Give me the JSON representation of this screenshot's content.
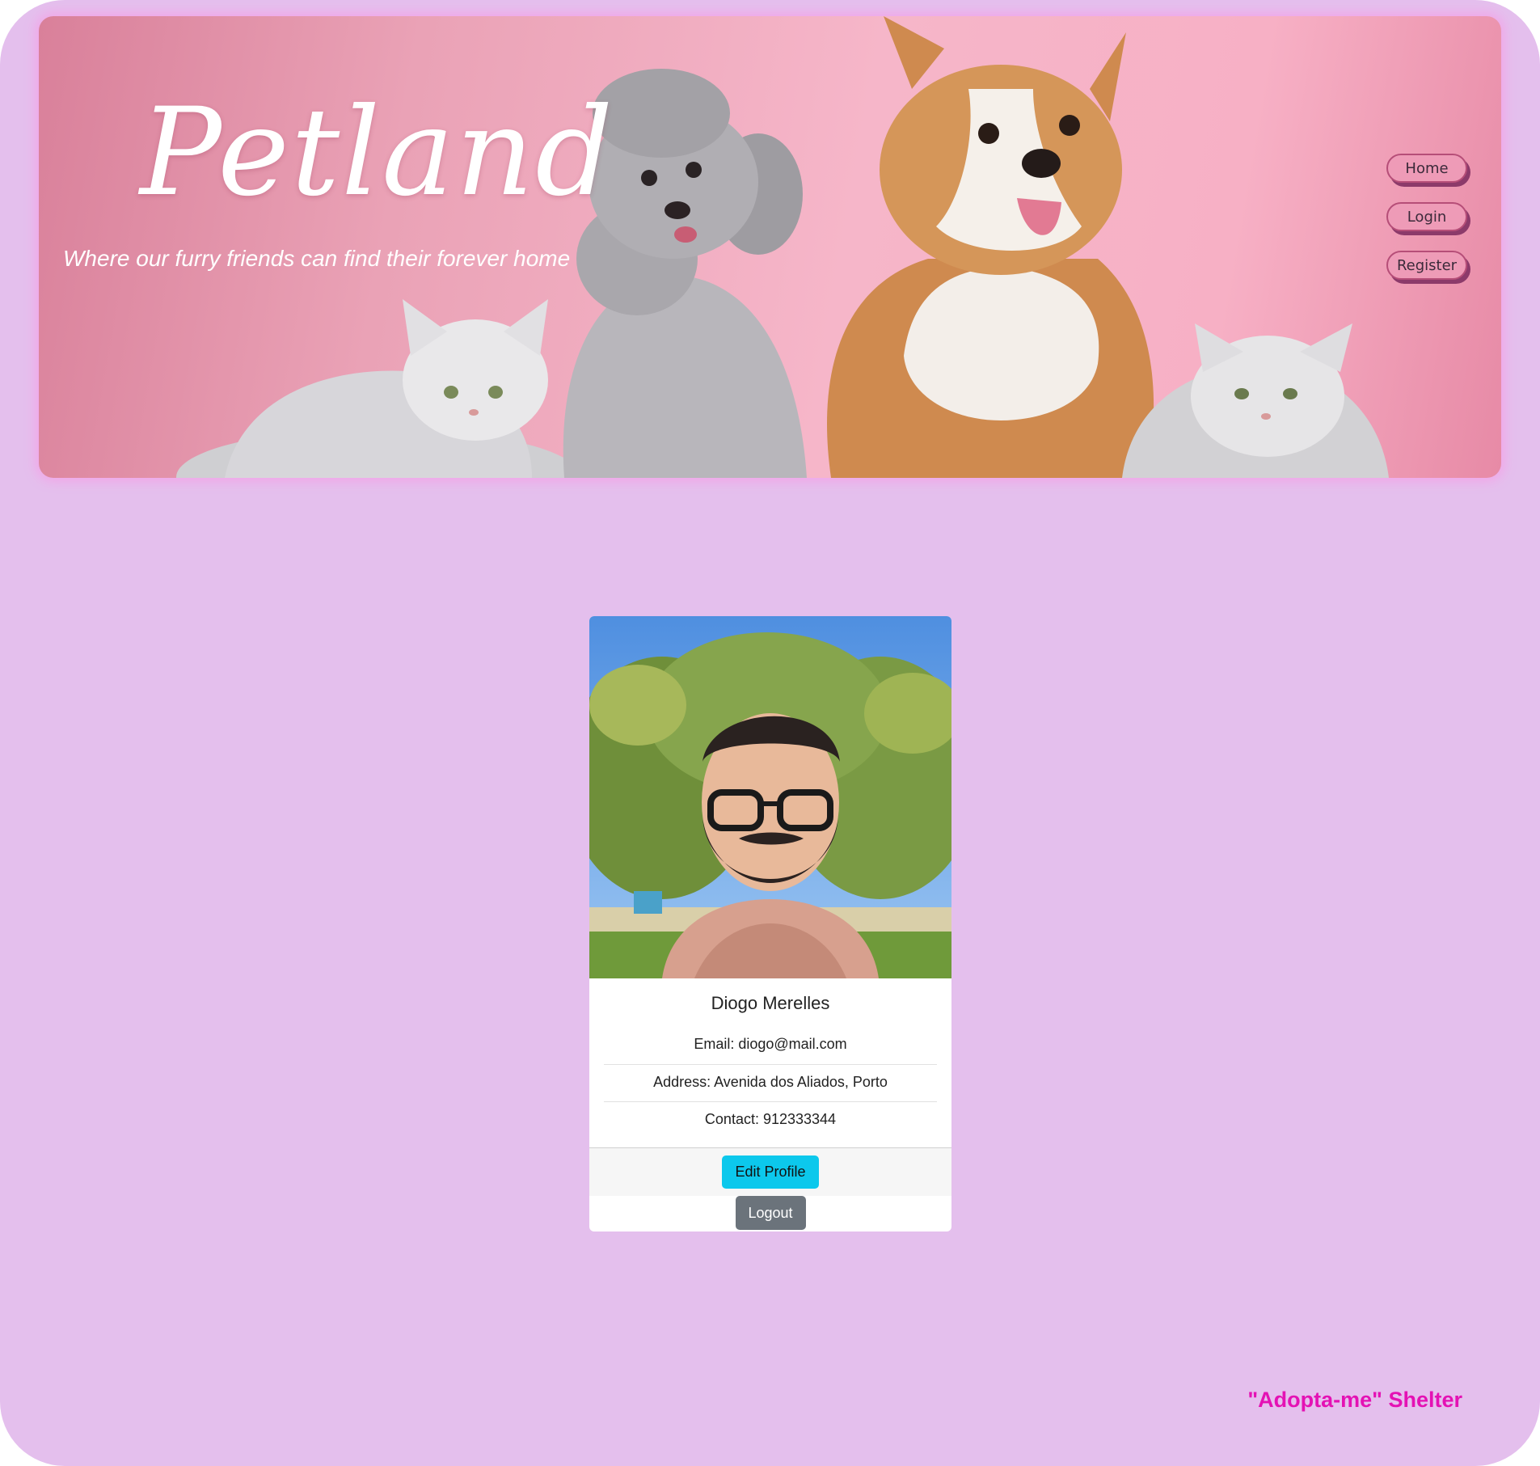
{
  "header": {
    "title": "Petland",
    "tagline": "Where our furry friends can find their forever home",
    "nav": [
      {
        "label": "Home"
      },
      {
        "label": "Login"
      },
      {
        "label": "Register"
      }
    ]
  },
  "profile": {
    "name": "Diogo Merelles",
    "email": "Email: diogo@mail.com",
    "address": "Address: Avenida dos Aliados, Porto",
    "contact": "Contact: 912333344",
    "edit_label": "Edit Profile",
    "logout_label": "Logout"
  },
  "footer": {
    "shelter": "\"Adopta-me\" Shelter"
  },
  "colors": {
    "page_background": "#e4bfed",
    "banner_pink": "#f6b6c9",
    "edit_button": "#0cc8ec",
    "logout_button": "#6b737b",
    "footer_text": "#e412b4"
  }
}
